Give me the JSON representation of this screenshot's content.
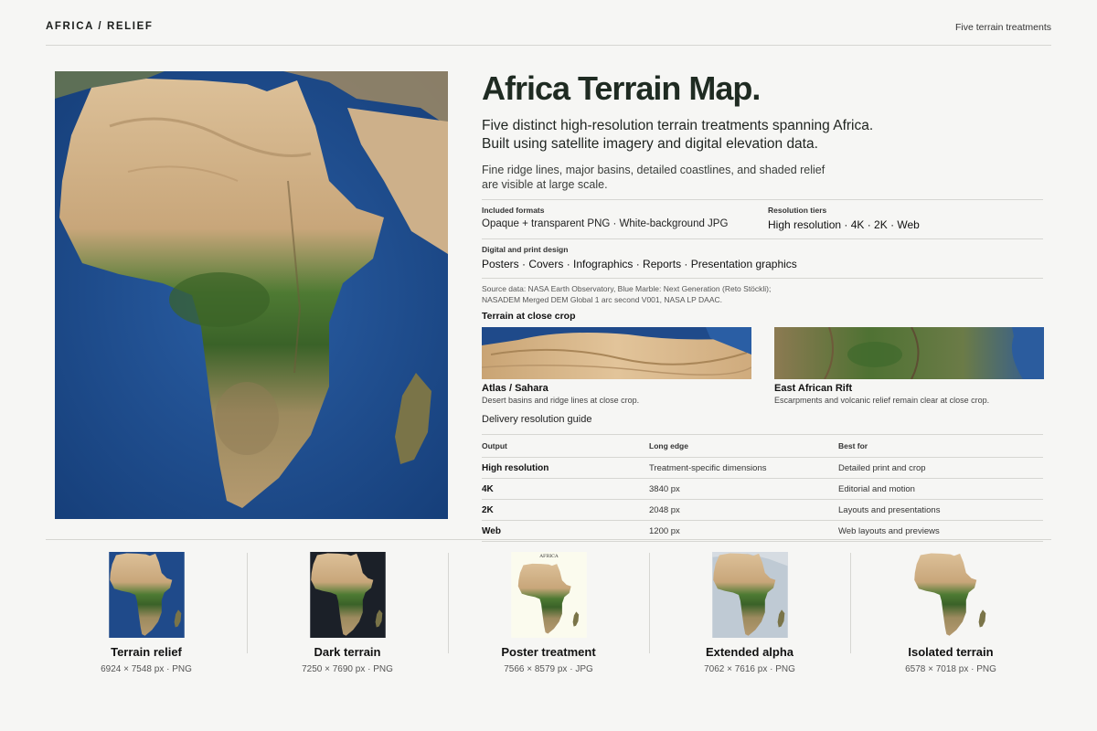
{
  "header": {
    "brand": "AFRICA / RELIEF",
    "right_label": "Five terrain treatments"
  },
  "hero": {
    "title": "Africa Terrain Map.",
    "lead_lines": [
      "Five distinct high-resolution terrain treatments spanning Africa.",
      "Built using satellite imagery and digital elevation data."
    ],
    "desc_lines": [
      "Fine ridge lines, major basins, detailed coastlines, and shaded relief",
      "are visible at large scale."
    ]
  },
  "specs": {
    "formats_label": "Included formats",
    "formats_value": "Opaque + transparent PNG · White-background JPG",
    "resolution_label": "Resolution tiers",
    "resolution_value": "High resolution · 4K · 2K · Web",
    "usage_label": "Digital and print design",
    "usage_value": "Posters · Covers · Infographics · Reports · Presentation graphics"
  },
  "source_lines": [
    "Source data: NASA Earth Observatory, Blue Marble: Next Generation (Reto Stöckli);",
    "NASADEM Merged DEM Global 1 arc second V001, NASA LP DAAC."
  ],
  "closeup": {
    "heading": "Terrain at close crop",
    "crops": [
      {
        "title": "Atlas / Sahara",
        "desc": "Desert basins and ridge lines at close crop."
      },
      {
        "title": "East African Rift",
        "desc": "Escarpments and volcanic relief remain clear at close crop."
      }
    ]
  },
  "guide": {
    "title": "Delivery resolution guide",
    "headers": [
      "Output",
      "Long edge",
      "Best for"
    ],
    "rows": [
      [
        "High resolution",
        "Treatment-specific dimensions",
        "Detailed print and crop"
      ],
      [
        "4K",
        "3840 px",
        "Editorial and motion"
      ],
      [
        "2K",
        "2048 px",
        "Layouts and presentations"
      ],
      [
        "Web",
        "1200 px",
        "Web layouts and previews"
      ]
    ]
  },
  "gallery": [
    {
      "title": "Terrain relief",
      "meta": "6924 × 7548 px · PNG",
      "bg": "#1f4a8a"
    },
    {
      "title": "Dark terrain",
      "meta": "7250 × 7690 px · PNG",
      "bg": "#1b2028"
    },
    {
      "title": "Poster treatment",
      "meta": "7566 × 8579 px · JPG",
      "bg": "#fbfbee",
      "poster_text": "AFRICA"
    },
    {
      "title": "Extended alpha",
      "meta": "7062 × 7616 px · PNG",
      "bg": "#bfcad4"
    },
    {
      "title": "Isolated terrain",
      "meta": "6578 × 7018 px · PNG",
      "bg": "#f6f6f4"
    }
  ],
  "colors": {
    "ocean": "#1f4a8a",
    "desert": "#d6b78a",
    "forest": "#3b6b2a",
    "rule": "#d6d6d2",
    "title": "#1f2b22"
  }
}
